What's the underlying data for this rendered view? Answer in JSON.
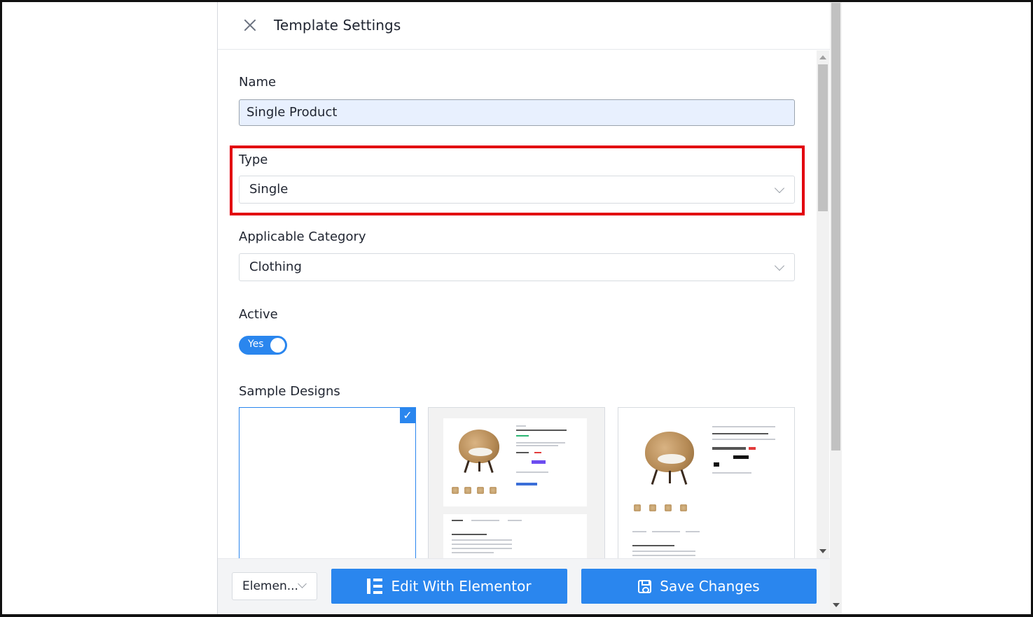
{
  "header": {
    "title": "Template Settings"
  },
  "form": {
    "name_label": "Name",
    "name_value": "Single Product",
    "type_label": "Type",
    "type_value": "Single",
    "category_label": "Applicable Category",
    "category_value": "Clothing",
    "active_label": "Active",
    "active_toggle_text": "Yes",
    "active_on": true,
    "sample_designs_label": "Sample Designs"
  },
  "samples": [
    {
      "id": "blank",
      "selected": true
    },
    {
      "id": "design-1",
      "selected": false
    },
    {
      "id": "design-2",
      "selected": false
    }
  ],
  "footer": {
    "builder_select_value": "Elemen...",
    "edit_button_label": "Edit With Elementor",
    "save_button_label": "Save Changes"
  },
  "colors": {
    "accent": "#2a86ee",
    "highlight": "#e2000f"
  },
  "icons": [
    "close-icon",
    "chevron-down-icon",
    "check-icon",
    "elementor-icon",
    "save-icon"
  ]
}
